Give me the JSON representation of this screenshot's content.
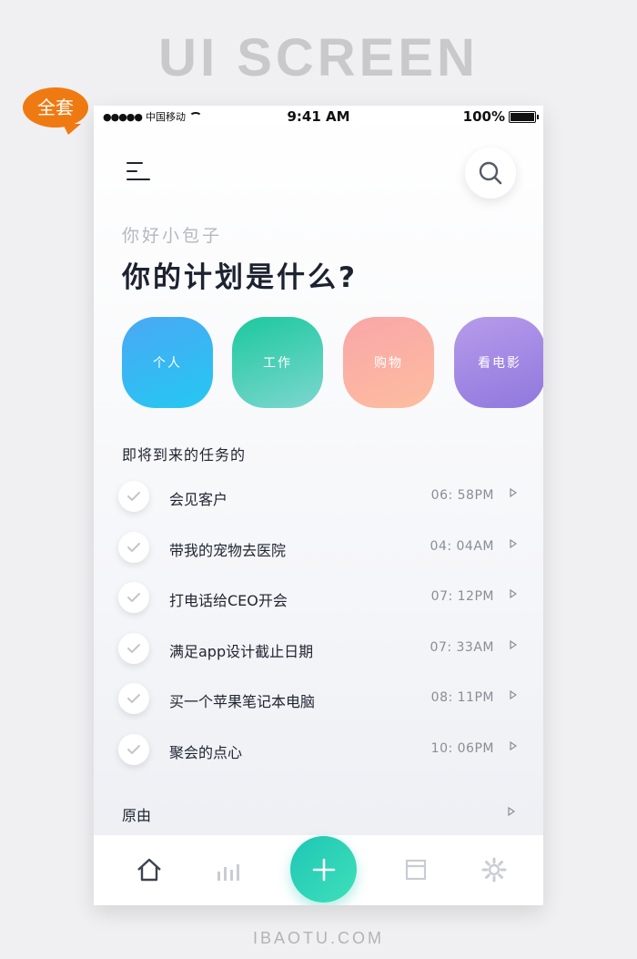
{
  "poster": {
    "title": "UI SCREEN",
    "badge": "全套",
    "footer_url": "IBAOTU.COM"
  },
  "status_bar": {
    "carrier": "中国移动",
    "time": "9:41 AM",
    "battery": "100%",
    "battery_level": 1.0
  },
  "header": {
    "menu_icon": "menu-icon",
    "search_icon": "search-icon"
  },
  "greeting": "你好小包子",
  "headline": "你的计划是什么?",
  "categories": [
    {
      "label": "个人",
      "colors": [
        "#4aa8f4",
        "#24c8f2"
      ]
    },
    {
      "label": "工作",
      "colors": [
        "#1cc89e",
        "#7dd7cf"
      ]
    },
    {
      "label": "购物",
      "colors": [
        "#f9a6a8",
        "#fdbda0"
      ]
    },
    {
      "label": "看电影",
      "colors": [
        "#b79bea",
        "#8f78de"
      ]
    }
  ],
  "upcoming": {
    "title": "即将到来的任务的",
    "tasks": [
      {
        "label": "会见客户",
        "time": "06: 58PM"
      },
      {
        "label": "带我的宠物去医院",
        "time": "04: 04AM"
      },
      {
        "label": "打电话给CEO开会",
        "time": "07: 12PM"
      },
      {
        "label": "满足app设计截止日期",
        "time": "07: 33AM"
      },
      {
        "label": "买一个苹果笔记本电脑",
        "time": "08: 11PM"
      },
      {
        "label": "聚会的点心",
        "time": "10: 06PM"
      }
    ]
  },
  "reason": {
    "label": "原由"
  },
  "tabbar": {
    "items": [
      "home-icon",
      "stats-icon",
      "add-icon",
      "calendar-icon",
      "settings-icon"
    ],
    "accent": "#1ec6b5"
  }
}
